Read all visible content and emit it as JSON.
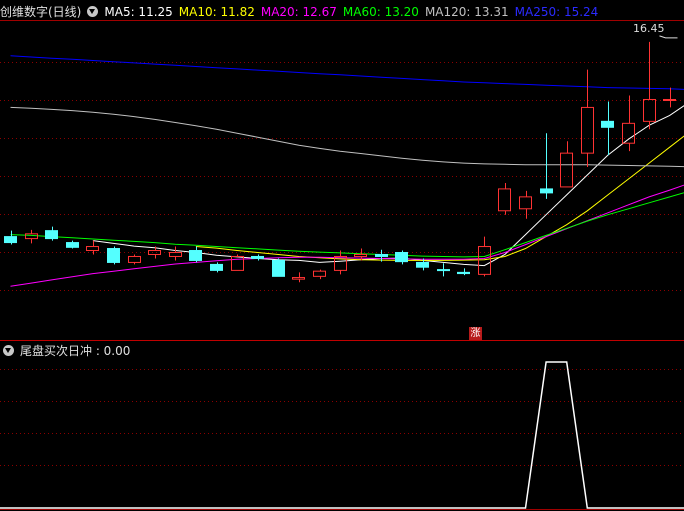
{
  "main_header": {
    "title": "创维数字(日线)",
    "ma5_label": "MA5: 11.25",
    "ma10_label": "MA10: 11.82",
    "ma20_label": "MA20: 12.67",
    "ma60_label": "MA60: 13.20",
    "ma120_label": "MA120: 13.31",
    "ma250_label": "MA250: 15.24"
  },
  "sub_header": {
    "indicator_label": "尾盘买次日冲 : 0.00"
  },
  "peak_label": "16.45",
  "limit_up_badge": "涨",
  "colors": {
    "ma5": "#ffffff",
    "ma10": "#ffff00",
    "ma20": "#ff00ff",
    "ma60": "#00ff00",
    "ma120": "#c0c0c0",
    "ma250": "#0000ff",
    "up": "#ff3333",
    "down": "#54ffff",
    "grid": "#8b0000"
  },
  "chart_data": [
    {
      "type": "candlestick",
      "title": "创维数字(日线)",
      "ylim": [
        9.2,
        17.0
      ],
      "candles": [
        {
          "o": 11.55,
          "h": 11.7,
          "l": 11.35,
          "c": 11.4
        },
        {
          "o": 11.5,
          "h": 11.72,
          "l": 11.38,
          "c": 11.62
        },
        {
          "o": 11.7,
          "h": 11.8,
          "l": 11.45,
          "c": 11.5
        },
        {
          "o": 11.4,
          "h": 11.45,
          "l": 11.25,
          "c": 11.28
        },
        {
          "o": 11.2,
          "h": 11.45,
          "l": 11.1,
          "c": 11.3
        },
        {
          "o": 11.25,
          "h": 11.3,
          "l": 10.85,
          "c": 10.9
        },
        {
          "o": 10.9,
          "h": 11.1,
          "l": 10.85,
          "c": 11.05
        },
        {
          "o": 11.1,
          "h": 11.3,
          "l": 11.0,
          "c": 11.2
        },
        {
          "o": 11.05,
          "h": 11.3,
          "l": 10.95,
          "c": 11.15
        },
        {
          "o": 11.2,
          "h": 11.3,
          "l": 10.9,
          "c": 10.95
        },
        {
          "o": 10.85,
          "h": 10.9,
          "l": 10.65,
          "c": 10.7
        },
        {
          "o": 10.7,
          "h": 11.1,
          "l": 10.7,
          "c": 11.05
        },
        {
          "o": 11.05,
          "h": 11.1,
          "l": 10.95,
          "c": 11.0
        },
        {
          "o": 10.95,
          "h": 11.0,
          "l": 10.55,
          "c": 10.55
        },
        {
          "o": 10.48,
          "h": 10.65,
          "l": 10.4,
          "c": 10.52
        },
        {
          "o": 10.55,
          "h": 10.72,
          "l": 10.48,
          "c": 10.68
        },
        {
          "o": 10.7,
          "h": 11.2,
          "l": 10.6,
          "c": 11.05
        },
        {
          "o": 11.05,
          "h": 11.25,
          "l": 10.95,
          "c": 11.1
        },
        {
          "o": 11.1,
          "h": 11.22,
          "l": 10.92,
          "c": 11.05
        },
        {
          "o": 11.15,
          "h": 11.2,
          "l": 10.85,
          "c": 10.92
        },
        {
          "o": 10.9,
          "h": 11.0,
          "l": 10.7,
          "c": 10.78
        },
        {
          "o": 10.72,
          "h": 10.88,
          "l": 10.55,
          "c": 10.7
        },
        {
          "o": 10.65,
          "h": 10.75,
          "l": 10.58,
          "c": 10.62
        },
        {
          "o": 10.6,
          "h": 11.55,
          "l": 10.55,
          "c": 11.3
        },
        {
          "o": 12.2,
          "h": 12.9,
          "l": 12.1,
          "c": 12.75
        },
        {
          "o": 12.25,
          "h": 12.7,
          "l": 12.0,
          "c": 12.55
        },
        {
          "o": 12.75,
          "h": 14.15,
          "l": 12.5,
          "c": 12.65
        },
        {
          "o": 12.8,
          "h": 13.95,
          "l": 12.8,
          "c": 13.65
        },
        {
          "o": 13.65,
          "h": 15.75,
          "l": 13.3,
          "c": 14.8
        },
        {
          "o": 14.45,
          "h": 14.95,
          "l": 13.6,
          "c": 14.3
        },
        {
          "o": 13.9,
          "h": 15.1,
          "l": 13.7,
          "c": 14.4
        },
        {
          "o": 14.45,
          "h": 16.45,
          "l": 14.25,
          "c": 15.0
        },
        {
          "o": 15.0,
          "h": 15.3,
          "l": 14.8,
          "c": 15.0
        },
        {
          "o": 14.2,
          "h": 14.25,
          "l": 13.6,
          "c": 13.7
        },
        {
          "o": 13.45,
          "h": 13.8,
          "l": 13.25,
          "c": 13.35
        }
      ],
      "ma_series": [
        {
          "name": "MA5",
          "values": [
            null,
            null,
            null,
            null,
            11.45,
            11.38,
            11.31,
            11.27,
            11.2,
            11.15,
            11.08,
            11.04,
            11.0,
            10.97,
            10.95,
            10.9,
            10.93,
            10.97,
            11.0,
            11.01,
            10.95,
            10.9,
            10.85,
            10.82,
            11.1,
            11.6,
            12.1,
            12.6,
            13.1,
            13.6,
            14.0,
            14.35,
            14.6,
            14.95,
            15.2
          ]
        },
        {
          "name": "MA10",
          "values": [
            null,
            null,
            null,
            null,
            null,
            null,
            null,
            null,
            null,
            11.3,
            11.26,
            11.2,
            11.15,
            11.1,
            11.05,
            11.02,
            10.99,
            10.97,
            10.96,
            10.95,
            10.95,
            10.95,
            10.96,
            10.97,
            11.05,
            11.25,
            11.55,
            11.85,
            12.2,
            12.6,
            13.0,
            13.4,
            13.8,
            14.2,
            14.4
          ]
        },
        {
          "name": "MA20",
          "values": [
            10.3,
            10.38,
            10.46,
            10.54,
            10.62,
            10.68,
            10.74,
            10.8,
            10.86,
            10.9,
            10.94,
            10.98,
            11.0,
            11.02,
            11.03,
            11.03,
            11.02,
            11.01,
            11.0,
            10.99,
            10.98,
            10.98,
            10.98,
            11.0,
            11.15,
            11.35,
            11.55,
            11.75,
            11.95,
            12.15,
            12.35,
            12.55,
            12.72,
            12.9,
            13.05
          ]
        },
        {
          "name": "MA60",
          "values": [
            11.6,
            11.58,
            11.55,
            11.52,
            11.49,
            11.46,
            11.43,
            11.4,
            11.36,
            11.33,
            11.3,
            11.27,
            11.24,
            11.21,
            11.18,
            11.16,
            11.14,
            11.12,
            11.1,
            11.08,
            11.06,
            11.05,
            11.04,
            11.05,
            11.22,
            11.4,
            11.58,
            11.76,
            11.94,
            12.1,
            12.25,
            12.4,
            12.55,
            12.7,
            12.8
          ]
        },
        {
          "name": "MA120",
          "values": [
            14.8,
            14.78,
            14.75,
            14.72,
            14.68,
            14.63,
            14.57,
            14.5,
            14.42,
            14.34,
            14.25,
            14.15,
            14.05,
            13.95,
            13.85,
            13.77,
            13.7,
            13.64,
            13.58,
            13.52,
            13.47,
            13.43,
            13.4,
            13.38,
            13.37,
            13.36,
            13.36,
            13.36,
            13.36,
            13.35,
            13.34,
            13.33,
            13.32,
            13.31,
            13.31
          ]
        },
        {
          "name": "MA250",
          "values": [
            16.1,
            16.07,
            16.04,
            16.01,
            15.98,
            15.95,
            15.92,
            15.89,
            15.86,
            15.83,
            15.8,
            15.77,
            15.74,
            15.71,
            15.68,
            15.65,
            15.62,
            15.59,
            15.56,
            15.53,
            15.5,
            15.47,
            15.44,
            15.42,
            15.4,
            15.38,
            15.36,
            15.34,
            15.32,
            15.3,
            15.29,
            15.28,
            15.27,
            15.25,
            15.24
          ]
        }
      ]
    },
    {
      "type": "line",
      "title": "尾盘买次日冲",
      "ylim": [
        0,
        1
      ],
      "series": [
        {
          "name": "尾盘买次日冲",
          "values": [
            0,
            0,
            0,
            0,
            0,
            0,
            0,
            0,
            0,
            0,
            0,
            0,
            0,
            0,
            0,
            0,
            0,
            0,
            0,
            0,
            0,
            0,
            0,
            0,
            0,
            0,
            1,
            1,
            0,
            0,
            0,
            0,
            0,
            0,
            0
          ]
        }
      ]
    }
  ]
}
